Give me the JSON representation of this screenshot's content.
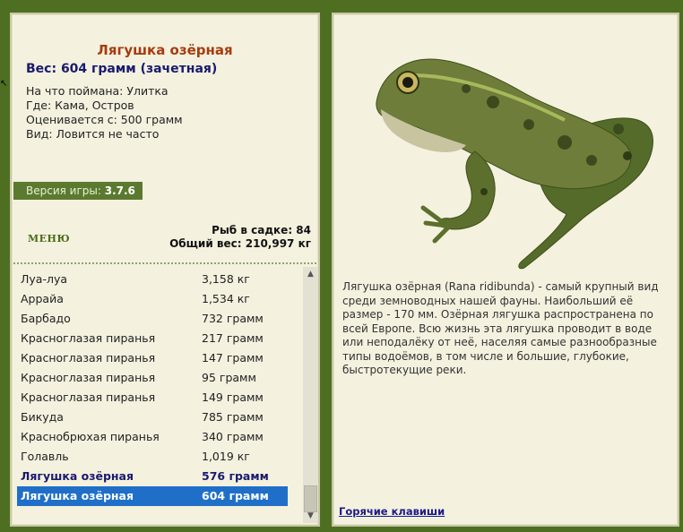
{
  "fish": {
    "title": "Лягушка озёрная",
    "weight_line": "Вес: 604 грамм (зачетная)",
    "caught_with": "На что поймана: Улитка",
    "location": "Где: Кама, Остров",
    "valued_from": "Оценивается с: 500 грамм",
    "rarity": "Вид: Ловится не часто"
  },
  "version": {
    "label": "Версия игры:",
    "value": "3.7.6"
  },
  "menu_label": "МЕНЮ",
  "stats": {
    "fish_in_net": "Рыб в садке: 84",
    "total_weight": "Общий вес: 210,997 кг"
  },
  "catch_list": [
    {
      "name": "Луа-луа",
      "weight": "3,158 кг"
    },
    {
      "name": "Аррайа",
      "weight": "1,534 кг"
    },
    {
      "name": "Барбадо",
      "weight": "732 грамм"
    },
    {
      "name": "Красноглазая пиранья",
      "weight": "217 грамм"
    },
    {
      "name": "Красноглазая пиранья",
      "weight": "147 грамм"
    },
    {
      "name": "Красноглазая пиранья",
      "weight": "95 грамм"
    },
    {
      "name": "Красноглазая пиранья",
      "weight": "149 грамм"
    },
    {
      "name": "Бикуда",
      "weight": "785 грамм"
    },
    {
      "name": "Краснобрюхая пиранья",
      "weight": "340 грамм"
    },
    {
      "name": "Голавль",
      "weight": "1,019 кг"
    },
    {
      "name": "Лягушка озёрная",
      "weight": "576 грамм"
    },
    {
      "name": "Лягушка озёрная",
      "weight": "604 грамм"
    }
  ],
  "description": "Лягушка озёрная (Rana ridibunda) - самый крупный вид среди земноводных нашей фауны. Наибольший её размер - 170 мм. Озёрная лягушка распространена по всей Европе. Всю жизнь эта лягушка проводит в воде или неподалёку от неё, населяя самые разнообразные типы водоёмов, в том числе и большие, глубокие, быстротекущие реки.",
  "hotkeys_label": "Горячие клавиши",
  "colors": {
    "background": "#4e6f22",
    "panel": "#f4f1df",
    "selected": "#1f6fc8",
    "title": "#a63c0f"
  }
}
